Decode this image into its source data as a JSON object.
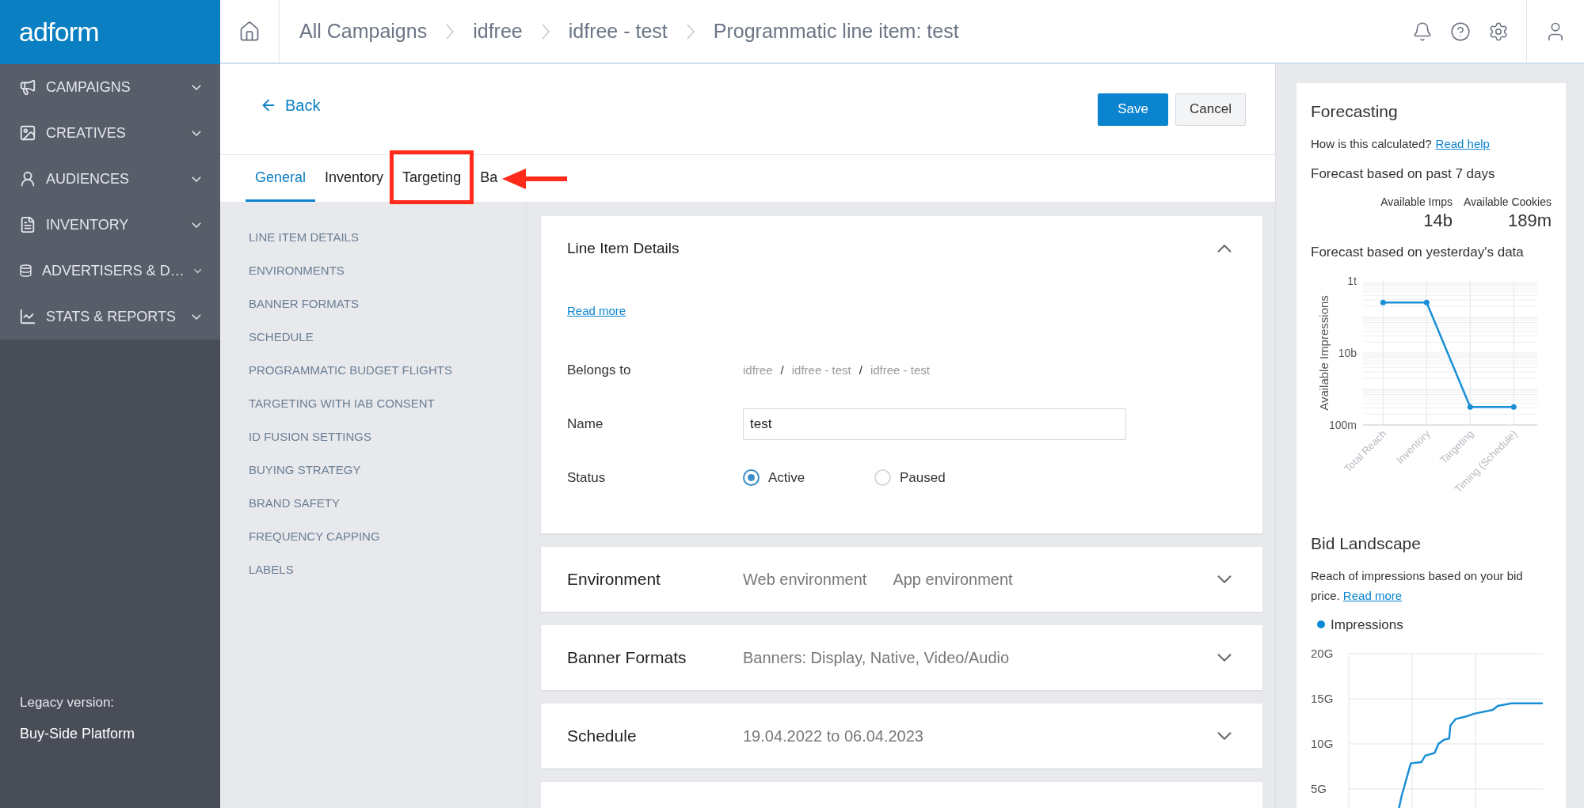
{
  "sidebar": {
    "logo": "adform",
    "items": [
      {
        "label": "CAMPAIGNS"
      },
      {
        "label": "CREATIVES"
      },
      {
        "label": "AUDIENCES"
      },
      {
        "label": "INVENTORY"
      },
      {
        "label": "ADVERTISERS & D…"
      },
      {
        "label": "STATS & REPORTS"
      }
    ],
    "footer_label": "Legacy version:",
    "footer_value": "Buy-Side Platform"
  },
  "breadcrumb": [
    "All Campaigns",
    "idfree",
    "idfree - test",
    "Programmatic line item: test"
  ],
  "back_link": "Back",
  "buttons": [
    {
      "label": "Save",
      "kind": "primary"
    },
    {
      "label": "Cancel",
      "kind": "secondary"
    }
  ],
  "tabs": [
    {
      "label": "General",
      "selected": true,
      "highlighted": false
    },
    {
      "label": "Inventory",
      "selected": false,
      "highlighted": false
    },
    {
      "label": "Targeting",
      "selected": false,
      "highlighted": true
    },
    {
      "label": "Ba",
      "selected": false,
      "highlighted": false
    }
  ],
  "annotation_arrow": true,
  "section_nav": [
    "LINE ITEM DETAILS",
    "ENVIRONMENTS",
    "BANNER FORMATS",
    "SCHEDULE",
    "PROGRAMMATIC BUDGET FLIGHTS",
    "TARGETING WITH IAB CONSENT",
    "ID FUSION SETTINGS",
    "BUYING STRATEGY",
    "BRAND SAFETY",
    "FREQUENCY CAPPING",
    "LABELS"
  ],
  "sections": [
    {
      "kind": "details",
      "title": "Line Item Details",
      "expanded": true,
      "read_more": "Read more",
      "belongs_to": {
        "label": "Belongs to",
        "path": [
          "idfree",
          "idfree - test",
          "idfree - test"
        ],
        "separator": "/"
      },
      "name": {
        "label": "Name",
        "value": "test"
      },
      "status": {
        "label": "Status",
        "options": [
          {
            "label": "Active",
            "selected": true
          },
          {
            "label": "Paused",
            "selected": false
          }
        ]
      }
    },
    {
      "kind": "summary",
      "title": "Environment",
      "expanded": false,
      "summary": [
        "Web environment",
        "App environment"
      ]
    },
    {
      "kind": "summary",
      "title": "Banner Formats",
      "expanded": false,
      "summary": [
        "Banners: Display, Native, Video/Audio"
      ]
    },
    {
      "kind": "summary",
      "title": "Schedule",
      "expanded": false,
      "summary": [
        "19.04.2022 to 06.04.2023"
      ]
    },
    {
      "kind": "cut_off"
    }
  ],
  "forecasting": {
    "title": "Forecasting",
    "help_text": "How is this calculated?",
    "help_link": "Read help",
    "subtitle": "Forecast based on past 7 days",
    "stats": [
      {
        "label": "Available Imps",
        "value": "14b"
      },
      {
        "label": "Available Cookies",
        "value": "189m"
      }
    ],
    "chart_heading": "Forecast based on yesterday's data",
    "chart": {
      "ylabel": "Available Impressions",
      "categories": [
        "Total Reach",
        "Inventory",
        "Targeting",
        "Timing (Schedule)"
      ],
      "y_labels": [
        "1t",
        "10b",
        "100m"
      ]
    }
  },
  "bid_landscape": {
    "title": "Bid Landscape",
    "text": "Reach of impressions based on your bid price.",
    "link": "Read more",
    "legend": "Impressions",
    "y_labels": [
      "20G",
      "15G",
      "10G",
      "5G"
    ]
  }
}
